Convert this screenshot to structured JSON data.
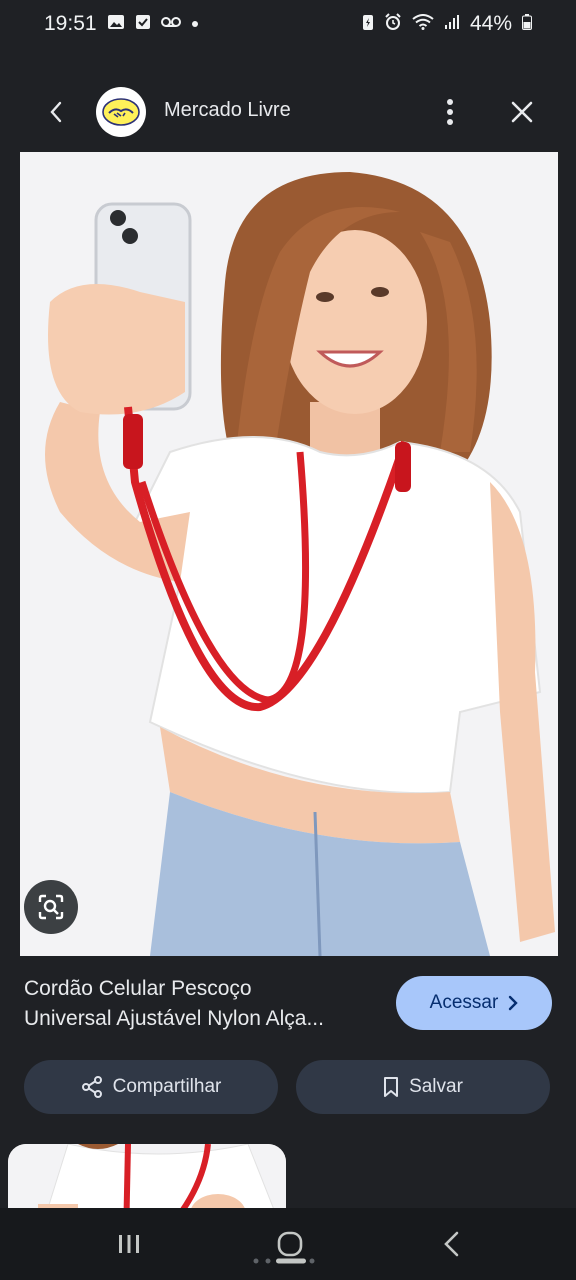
{
  "status_bar": {
    "time": "19:51",
    "battery": "44%",
    "icons": [
      "gallery-icon",
      "checkbox-icon",
      "voicemail-icon",
      "dot-icon",
      "battery-saver-icon",
      "alarm-icon",
      "wifi-icon",
      "signal-icon",
      "battery-icon"
    ]
  },
  "header": {
    "site_name": "Mercado Livre",
    "back_icon": "back-arrow-icon",
    "menu_icon": "more-vert-icon",
    "close_icon": "close-icon"
  },
  "result": {
    "title_line1": "Cordão Celular Pescoço",
    "title_line2": "Universal Ajustável Nylon Alça...",
    "visit_label": "Acessar",
    "share_label": "Compartilhar",
    "save_label": "Salvar"
  },
  "colors": {
    "background": "#1f2125",
    "accent_button": "#a8c7fa",
    "secondary_button": "#303846",
    "lanyard_red": "#d81f26"
  }
}
